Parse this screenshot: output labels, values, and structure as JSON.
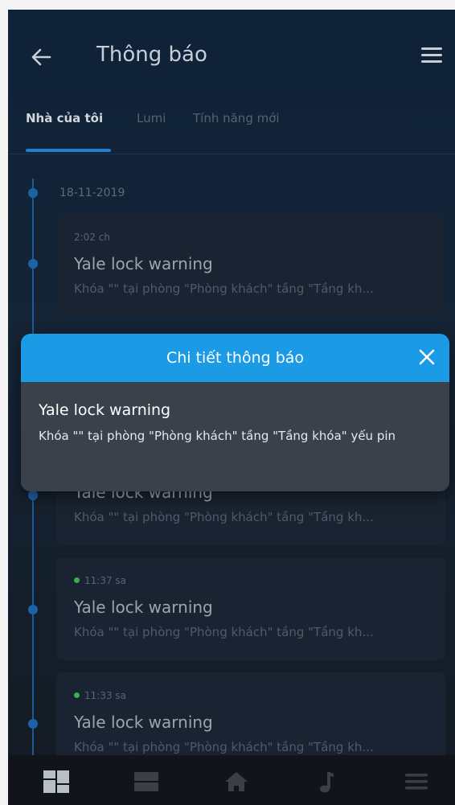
{
  "header": {
    "title": "Thông báo",
    "back_icon": "arrow-left-icon",
    "menu_icon": "hamburger-menu-icon"
  },
  "tabs": [
    {
      "label": "Nhà của tôi",
      "active": true
    },
    {
      "label": "Lumi",
      "active": false
    },
    {
      "label": "Tính năng mới",
      "active": false
    }
  ],
  "timeline": {
    "date": "18-11-2019"
  },
  "notifications": [
    {
      "time": "2:02 ch",
      "title": "Yale lock warning",
      "body": "Khóa \"\" tại phòng \"Phòng khách\" tầng \"Tầng kh...",
      "unread": false
    },
    {
      "time": "",
      "title": "Yale lock warning",
      "body": "Khóa \"\" tại phòng \"Phòng khách\" tầng \"Tầng kh...",
      "unread": false
    },
    {
      "time": "11:37 sa",
      "title": "Yale lock warning",
      "body": "Khóa \"\" tại phòng \"Phòng khách\" tầng \"Tầng kh...",
      "unread": true
    },
    {
      "time": "11:33 sa",
      "title": "Yale lock warning",
      "body": "Khóa \"\" tại phòng \"Phòng khách\" tầng \"Tầng kh...",
      "unread": true
    }
  ],
  "dialog": {
    "header": "Chi tiết thông báo",
    "message_title": "Yale lock warning",
    "message_body": "Khóa \"\" tại phòng \"Phòng khách\" tầng \"Tầng khóa\" yếu pin",
    "close_icon": "close-icon"
  },
  "bottom_nav": [
    {
      "icon": "dashboard-icon",
      "active": true
    },
    {
      "icon": "devices-icon",
      "active": false
    },
    {
      "icon": "home-icon",
      "active": false
    },
    {
      "icon": "music-note-icon",
      "active": false
    },
    {
      "icon": "menu-icon",
      "active": false
    }
  ],
  "colors": {
    "accent": "#1b9be6",
    "tab_underline": "#1d7fd3",
    "unread_dot": "#37b24d"
  }
}
